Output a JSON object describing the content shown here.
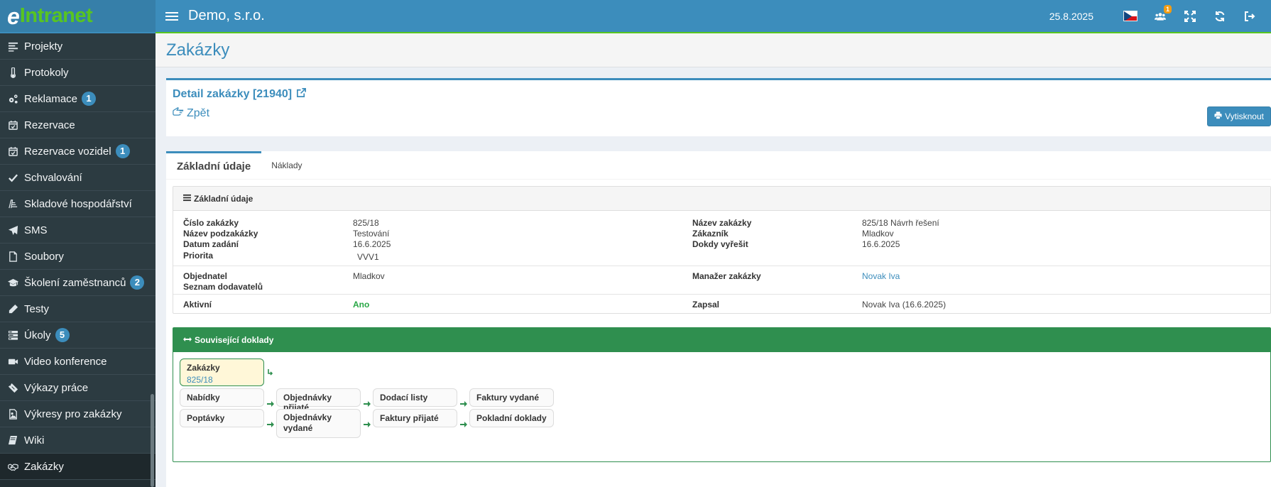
{
  "logo": {
    "prefix": "e",
    "text": "Intranet"
  },
  "sidebar": {
    "items": [
      {
        "label": "Projekty",
        "icon": "align-left-icon",
        "badge": ""
      },
      {
        "label": "Protokoly",
        "icon": "thermometer-icon",
        "badge": ""
      },
      {
        "label": "Reklamace",
        "icon": "cogs-icon",
        "badge": "1"
      },
      {
        "label": "Rezervace",
        "icon": "calendar-check-icon",
        "badge": ""
      },
      {
        "label": "Rezervace vozidel",
        "icon": "calendar-check-icon",
        "badge": "1"
      },
      {
        "label": "Schvalování",
        "icon": "check-icon",
        "badge": ""
      },
      {
        "label": "Skladové hospodářství",
        "icon": "warehouse-icon",
        "badge": ""
      },
      {
        "label": "SMS",
        "icon": "paper-plane-icon",
        "badge": ""
      },
      {
        "label": "Soubory",
        "icon": "file-icon",
        "badge": ""
      },
      {
        "label": "Školení zaměstnanců",
        "icon": "graduation-cap-icon",
        "badge": "2"
      },
      {
        "label": "Testy",
        "icon": "pencil-icon",
        "badge": ""
      },
      {
        "label": "Úkoly",
        "icon": "tasks-icon",
        "badge": "5"
      },
      {
        "label": "Video konference",
        "icon": "video-camera-icon",
        "badge": ""
      },
      {
        "label": "Výkazy práce",
        "icon": "ticket-icon",
        "badge": ""
      },
      {
        "label": "Výkresy pro zakázky",
        "icon": "image-file-icon",
        "badge": ""
      },
      {
        "label": "Wiki",
        "icon": "book-icon",
        "badge": ""
      },
      {
        "label": "Zakázky",
        "icon": "handshake-icon",
        "badge": "",
        "active": true
      }
    ]
  },
  "header": {
    "company": "Demo, s.r.o.",
    "date": "25.8.2025",
    "users_badge": "1"
  },
  "page": {
    "title": "Zakázky",
    "detail_title": "Detail zakázky [21940]",
    "back_label": "Zpět",
    "print_label": "Vytisknout"
  },
  "tabs": [
    {
      "label": "Základní údaje",
      "active": true
    },
    {
      "label": "Náklady",
      "active": false
    }
  ],
  "basic": {
    "heading": "Základní údaje",
    "left": [
      {
        "label": "Číslo zakázky",
        "value": "825/18"
      },
      {
        "label": "Název podzakázky",
        "value": "Testování"
      },
      {
        "label": "Datum zadání",
        "value": "16.6.2025"
      },
      {
        "label": "Priorita",
        "value": "VVV1"
      }
    ],
    "right": [
      {
        "label": "Název zakázky",
        "value": "825/18 Návrh řešení"
      },
      {
        "label": "Zákazník",
        "value": "Mladkov"
      },
      {
        "label": "Dokdy vyřešit",
        "value": "16.6.2025"
      }
    ],
    "group2_left": [
      {
        "label": "Objednatel",
        "value": "Mladkov"
      },
      {
        "label": "Seznam dodavatelů",
        "value": ""
      }
    ],
    "group2_right": [
      {
        "label": "Manažer zakázky",
        "value": "Novak Iva"
      }
    ],
    "group3_left": [
      {
        "label": "Aktivní",
        "value": "Ano"
      }
    ],
    "group3_right": [
      {
        "label": "Zapsal",
        "value": "Novak Iva (16.6.2025)"
      }
    ]
  },
  "related": {
    "heading": "Související doklady",
    "current": {
      "label": "Zakázky",
      "sub": "825/18"
    },
    "row1": [
      "Nabídky",
      "Objednávky přijaté",
      "Dodací listy",
      "Faktury vydané"
    ],
    "row2": [
      "Poptávky",
      "Objednávky vydané",
      "Faktury přijaté",
      "Pokladní doklady"
    ]
  },
  "colors": {
    "header": "#3c8dbc",
    "sidebar": "#222d32",
    "accent_green": "#58c521",
    "docs_green": "#2f8f4f"
  }
}
